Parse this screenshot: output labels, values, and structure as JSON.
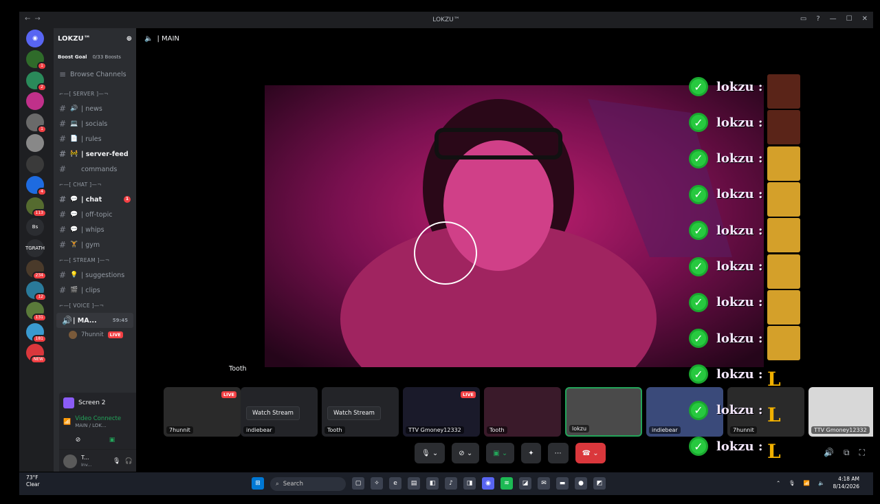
{
  "window": {
    "title": "LOKZU™"
  },
  "servers": [
    {
      "label": "",
      "badge": "1"
    },
    {
      "label": "",
      "badge": "2"
    },
    {
      "label": "",
      "badge": ""
    },
    {
      "label": "",
      "badge": "1"
    },
    {
      "label": "",
      "badge": ""
    },
    {
      "label": "",
      "badge": ""
    },
    {
      "label": "",
      "badge": "4"
    },
    {
      "label": "",
      "badge": "113"
    },
    {
      "label": "Bs",
      "badge": ""
    },
    {
      "label": "TGRATH",
      "badge": ""
    },
    {
      "label": "",
      "badge": "234"
    },
    {
      "label": "",
      "badge": "12"
    },
    {
      "label": "",
      "badge": "131"
    },
    {
      "label": "",
      "badge": "181"
    },
    {
      "label": "",
      "badge": "NEW"
    }
  ],
  "sidebar": {
    "server_name": "LOKZU™",
    "boost_goal": "Boost Goal",
    "boost_count": "0/33 Boosts",
    "browse": "Browse Channels",
    "categories": {
      "server": "⌐—[ SERVER ]—¬",
      "chat": "⌐—[ CHAT ]—¬",
      "stream": "⌐—[ STREAM ]—¬",
      "voice": "⌐—[ VOICE ]—¬"
    },
    "server_channels": [
      {
        "emoji": "🔊",
        "name": "| news"
      },
      {
        "emoji": "💻",
        "name": "| socials"
      },
      {
        "emoji": "📄",
        "name": "| rules"
      },
      {
        "emoji": "🚧",
        "name": "| server-feed"
      },
      {
        "emoji": "",
        "name": "commands"
      }
    ],
    "chat_channels": [
      {
        "emoji": "💬",
        "name": "| chat",
        "badge": "1"
      },
      {
        "emoji": "💬",
        "name": "| off-topic",
        "badge": ""
      },
      {
        "emoji": "💬",
        "name": "| whips",
        "badge": ""
      },
      {
        "emoji": "🏋",
        "name": "| gym",
        "badge": ""
      }
    ],
    "stream_channels": [
      {
        "emoji": "💡",
        "name": "| suggestions"
      },
      {
        "emoji": "🎬",
        "name": "| clips"
      }
    ],
    "voice_channel": {
      "name": "| MA...",
      "time": "59:45"
    },
    "voice_user": {
      "name": "7hunnit",
      "live": "LIVE"
    }
  },
  "share_panel": {
    "screen": "Screen 2",
    "status": "Video Connecte",
    "channel": "MAIN / LOK...",
    "user": "T...",
    "user_sub": "Inv..."
  },
  "stage": {
    "channel": "| MAIN",
    "hover_name": "Tooth",
    "tiles": [
      {
        "name": "7hunnit",
        "live": "LIVE",
        "button": ""
      },
      {
        "name": "indiebear",
        "live": "",
        "button": "Watch Stream"
      },
      {
        "name": "Tooth",
        "live": "",
        "button": "Watch Stream"
      },
      {
        "name": "TTV Gmoney12332",
        "live": "LIVE",
        "button": ""
      },
      {
        "name": "Tooth",
        "live": "",
        "button": ""
      },
      {
        "name": "lokzu",
        "live": "",
        "button": ""
      },
      {
        "name": "indiebear",
        "live": "",
        "button": ""
      },
      {
        "name": "7hunnit",
        "live": "",
        "button": ""
      },
      {
        "name": "TTV Gmoney12332",
        "live": "",
        "button": ""
      }
    ]
  },
  "chat_overlay": {
    "lines": [
      {
        "name": "lokzu :",
        "emote": "face"
      },
      {
        "name": "lokzu :",
        "emote": "face"
      },
      {
        "name": "lokzu :",
        "emote": "gold"
      },
      {
        "name": "lokzu :",
        "emote": "gold"
      },
      {
        "name": "lokzu :",
        "emote": "gold"
      },
      {
        "name": "lokzu :",
        "emote": "gold"
      },
      {
        "name": "lokzu :",
        "emote": "gold"
      },
      {
        "name": "lokzu :",
        "emote": "gold"
      },
      {
        "name": "lokzu :",
        "emote": "L"
      },
      {
        "name": "lokzu :",
        "emote": "L"
      },
      {
        "name": "lokzu :",
        "emote": "L"
      },
      {
        "name": "lokzu :",
        "emote": "L"
      }
    ],
    "L": "L"
  },
  "taskbar": {
    "temp": "73°F",
    "cond": "Clear",
    "search": "Search",
    "time": "4:18 AM",
    "date": "8/14/2026"
  }
}
